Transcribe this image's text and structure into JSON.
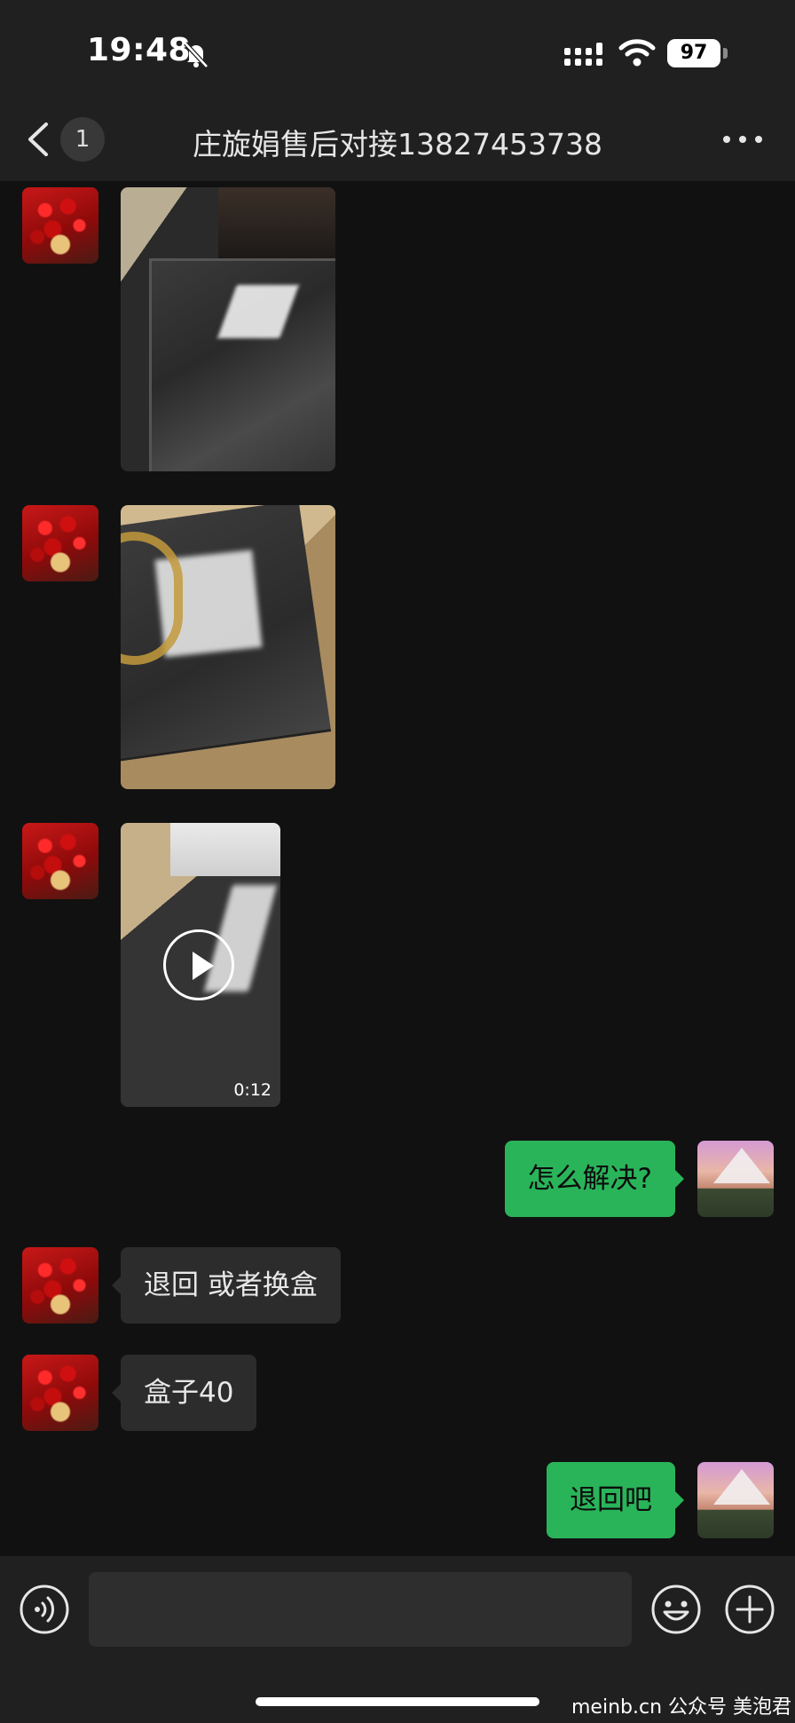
{
  "status_bar": {
    "time": "19:48",
    "battery_level": "97",
    "icons": [
      "bell-slash-icon",
      "signal-icon",
      "wifi-icon",
      "battery-icon"
    ]
  },
  "header": {
    "unread_count": "1",
    "title": "庄旋娟售后对接13827453738",
    "icons": [
      "chevron-left-icon",
      "more-icon"
    ]
  },
  "messages": [
    {
      "side": "in",
      "type": "image"
    },
    {
      "side": "in",
      "type": "image"
    },
    {
      "side": "in",
      "type": "video",
      "duration": "0:12"
    },
    {
      "side": "out",
      "type": "text",
      "text": "怎么解决?"
    },
    {
      "side": "in",
      "type": "text",
      "text": "退回 或者换盒"
    },
    {
      "side": "in",
      "type": "text",
      "text": "盒子40"
    },
    {
      "side": "out",
      "type": "text",
      "text": "退回吧"
    }
  ],
  "input_bar": {
    "icons": [
      "voice-icon",
      "emoji-icon",
      "plus-icon"
    ]
  },
  "watermark": "meinb.cn  公众号 美泡君",
  "colors": {
    "background": "#111111",
    "bar": "#202020",
    "incoming_bubble": "#2c2c2c",
    "outgoing_bubble": "#2ab45a"
  }
}
